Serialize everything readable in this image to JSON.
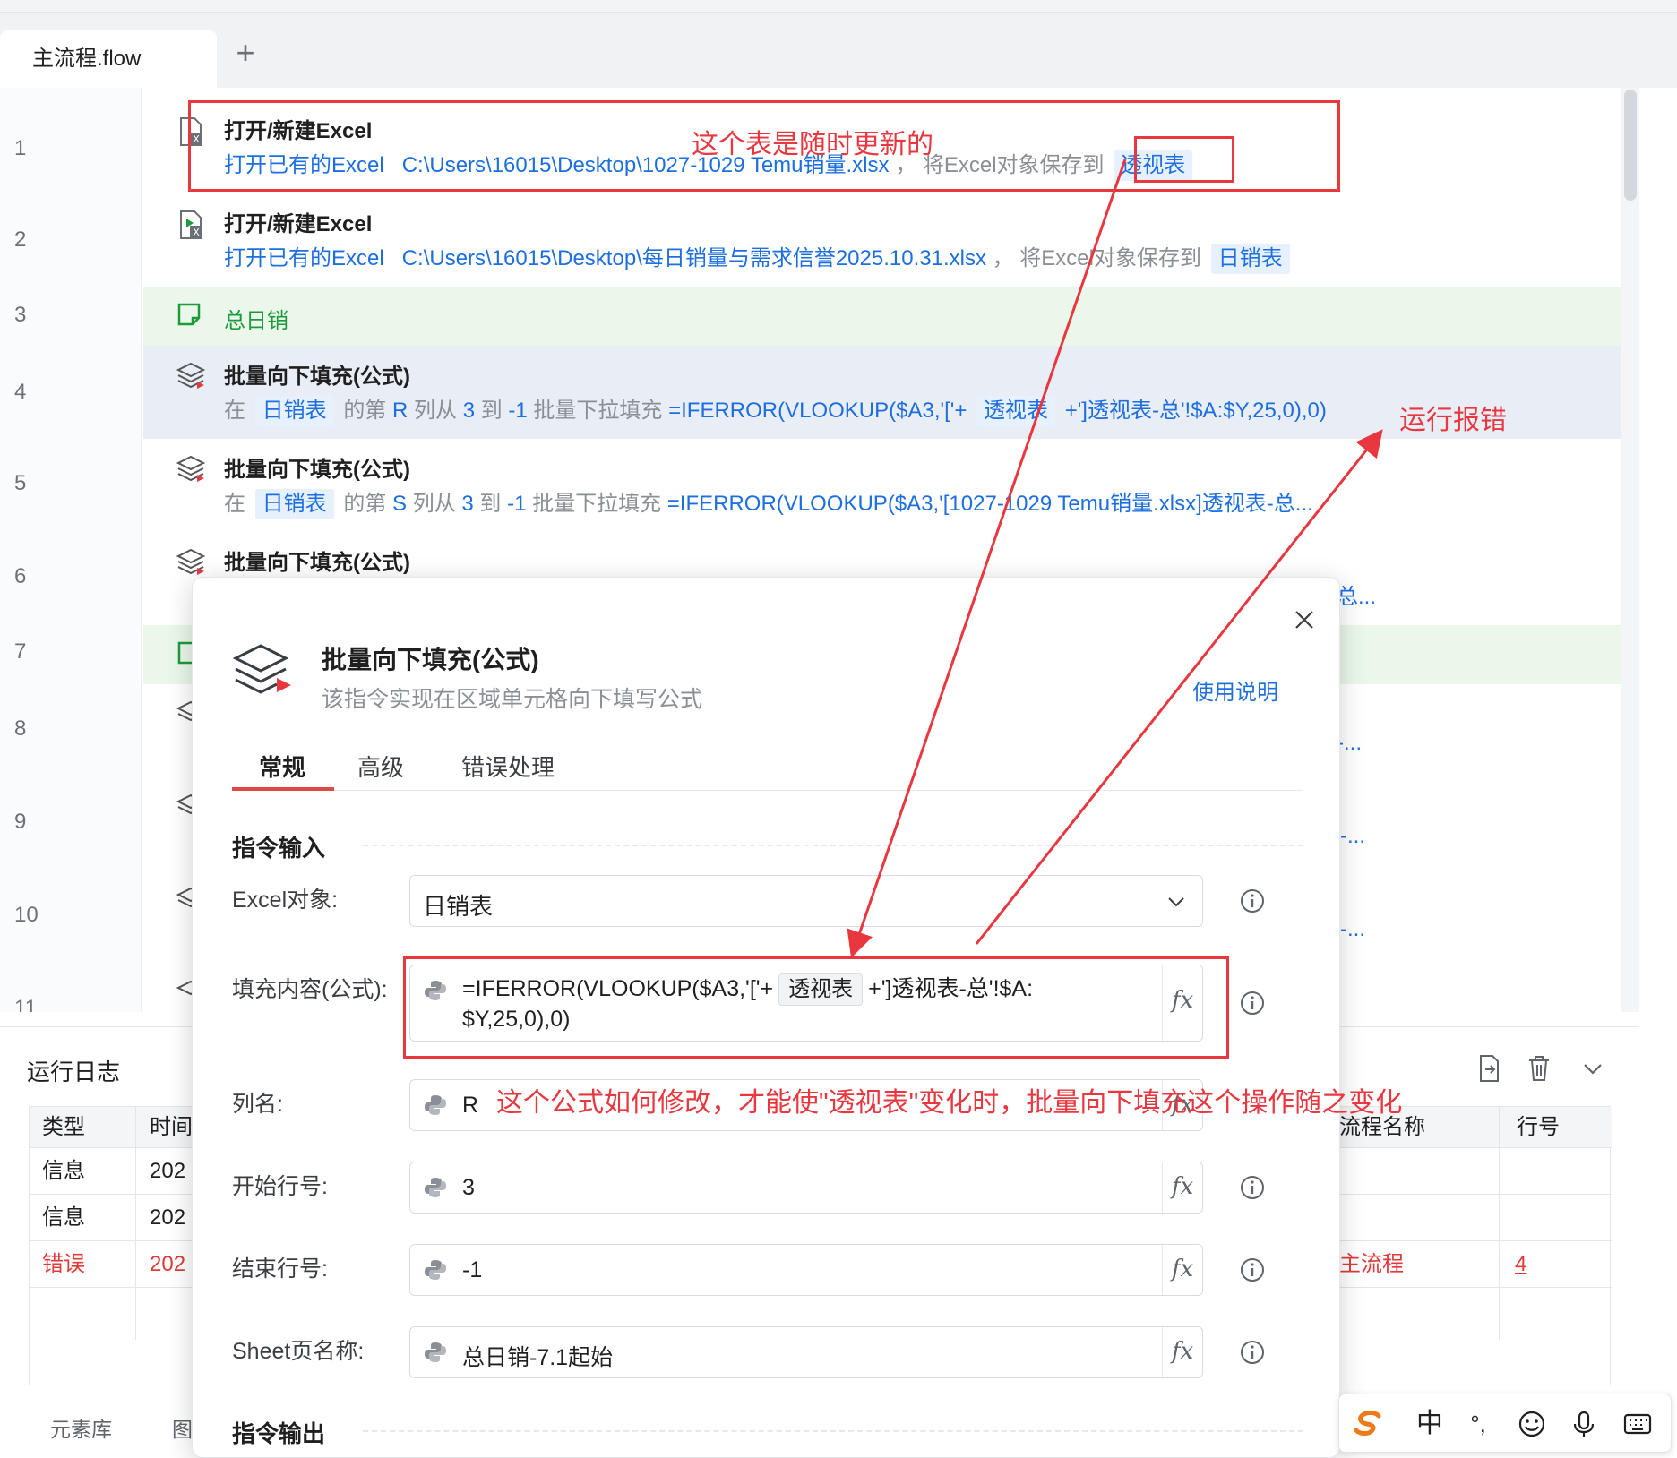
{
  "tabs": {
    "active": "主流程.flow",
    "add_icon": "+"
  },
  "line_numbers": [
    "1",
    "2",
    "3",
    "4",
    "5",
    "6",
    "7",
    "8",
    "9",
    "10",
    "11"
  ],
  "flow": {
    "rows": [
      {
        "title": "打开/新建Excel",
        "action": "打开已有的Excel",
        "path": "C:\\Users\\16015\\Desktop\\1027-1029 Temu销量.xlsx",
        "save_text": "， 将Excel对象保存到",
        "var": "透视表"
      },
      {
        "title": "打开/新建Excel",
        "action": "打开已有的Excel",
        "path": "C:\\Users\\16015\\Desktop\\每日销量与需求信誉2025.10.31.xlsx",
        "save_text": "， 将Excel对象保存到",
        "var": "日销表"
      },
      {
        "comment": "总日销"
      },
      {
        "title": "批量向下填充(公式)",
        "in": "在",
        "var": "日销表",
        "of_col": "的第",
        "col": "R",
        "from": "列从",
        "start": "3",
        "to": "到",
        "end": "-1",
        "fill": "批量下拉填充",
        "formula_pre": "=IFERROR(VLOOKUP($A3,'['+",
        "formula_var": "透视表",
        "formula_post": "+']透视表-总'!$A:$Y,25,0),0)"
      },
      {
        "title": "批量向下填充(公式)",
        "in": "在",
        "var": "日销表",
        "of_col": "的第",
        "col": "S",
        "from": "列从",
        "start": "3",
        "to": "到",
        "end": "-1",
        "fill": "批量下拉填充",
        "formula": "=IFERROR(VLOOKUP($A3,'[1027-1029 Temu销量.xlsx]透视表-总..."
      },
      {
        "title": "批量向下填充(公式)",
        "desc_tail": "总..."
      },
      {
        "desc_tail": "-..."
      },
      {
        "desc_tail": "-..."
      },
      {
        "desc_tail": "-..."
      }
    ]
  },
  "log": {
    "title": "运行日志",
    "tool_icons": [
      "export-icon",
      "trash-icon",
      "chevron-down-icon"
    ],
    "columns": [
      "类型",
      "时间",
      "流程名称",
      "行号"
    ],
    "rows": [
      {
        "type": "信息",
        "time": "202"
      },
      {
        "type": "信息",
        "time": "202"
      },
      {
        "type": "错误",
        "time": "202",
        "flow": "主流程",
        "line": "4"
      }
    ],
    "bottom_tabs": [
      "元素库",
      "图"
    ]
  },
  "modal": {
    "title": "批量向下填充(公式)",
    "subtitle": "该指令实现在区域单元格向下填写公式",
    "help": "使用说明",
    "tabs": [
      "常规",
      "高级",
      "错误处理"
    ],
    "section_input": "指令输入",
    "section_output": "指令输出",
    "fields": {
      "excel_label": "Excel对象:",
      "excel_value": "日销表",
      "content_label": "填充内容(公式):",
      "content_pre": "=IFERROR(VLOOKUP($A3,'['+",
      "content_var": "透视表",
      "content_post": "+']透视表-总'!$A:",
      "content_line2": "$Y,25,0),0)",
      "col_label": "列名:",
      "col_value": "R",
      "start_label": "开始行号:",
      "start_value": "3",
      "end_label": "结束行号:",
      "end_value": "-1",
      "sheet_label": "Sheet页名称:",
      "sheet_value": "总日销-7.1起始"
    },
    "fx": "fx"
  },
  "annotations": {
    "note_top": "这个表是随时更新的",
    "note_error": "运行报错",
    "note_question": "这个公式如何修改，才能使\"透视表\"变化时，批量向下填充这个操作随之变化"
  },
  "ime": {
    "lang": "中",
    "punct": "°,"
  },
  "colors": {
    "accent": "#1d6fe0",
    "annotation": "#e8373f",
    "comment_bg": "#eaf7ea",
    "selected_bg": "#e8edf6",
    "error": "#e03a3a"
  }
}
